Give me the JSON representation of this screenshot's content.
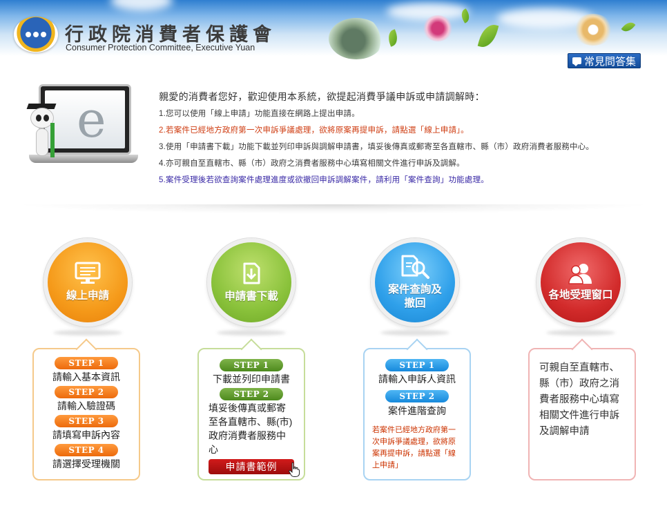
{
  "header": {
    "title_zh": "行政院消費者保護會",
    "title_en": "Consumer Protection Committee, Executive Yuan",
    "faq_label": "常見問答集"
  },
  "intro": {
    "heading": "親愛的消費者您好，歡迎使用本系統，欲提起消費爭議申訴或申請調解時：",
    "lines": [
      "1.您可以使用「線上申請」功能直接在網路上提出申請。",
      "2.若案件已經地方政府第一次申訴爭議處理，欲將原案再提申訴，請點選「線上申請」。",
      "3.使用「申請書下載」功能下載並列印申訴與調解申請書，填妥後傳真或郵寄至各直轄市、縣（市）政府消費者服務中心。",
      "4.亦可親自至直轄市、縣（市）政府之消費者服務中心填寫相關文件進行申訴及調解。",
      "5.案件受理後若欲查詢案件處理進度或欲撤回申訴調解案件，請利用「案件查詢」功能處理。"
    ]
  },
  "services": {
    "online": {
      "label": "線上申請",
      "steps": [
        {
          "tag": "STEP 1",
          "text": "請輸入基本資訊"
        },
        {
          "tag": "STEP 2",
          "text": "請輸入驗證碼"
        },
        {
          "tag": "STEP 3",
          "text": "請填寫申訴內容"
        },
        {
          "tag": "STEP 4",
          "text": "請選擇受理機關"
        }
      ]
    },
    "download": {
      "label": "申請書下載",
      "steps": [
        {
          "tag": "STEP 1",
          "text": "下載並列印申請書"
        },
        {
          "tag": "STEP 2",
          "text": "填妥後傳真或郵寄至各直轄市、縣(市)政府消費者服務中心"
        }
      ],
      "sample_button": "申請書範例"
    },
    "query": {
      "label_line1": "案件查詢及",
      "label_line2": "撤回",
      "steps": [
        {
          "tag": "STEP 1",
          "text": "請輸入申訴人資訊"
        },
        {
          "tag": "STEP 2",
          "text": "案件進階查詢"
        }
      ],
      "note": "若案件已經地方政府第一次申訴爭議處理，欲將原案再提申訴，請點選「線上申請」"
    },
    "offices": {
      "label": "各地受理窗口",
      "text": "可親自至直轄市、縣（市）政府之消費者服務中心填寫相關文件進行申訴及調解申請"
    }
  },
  "colors": {
    "orange": "#f59a1a",
    "green": "#8ac23b",
    "blue": "#2fa0ea",
    "red": "#d22b2b",
    "header_blue": "#2f7fd0"
  },
  "icons": [
    "faq-bubble-icon",
    "monitor-icon",
    "download-document-icon",
    "magnifier-document-icon",
    "people-icon",
    "hand-pointer-icon"
  ]
}
